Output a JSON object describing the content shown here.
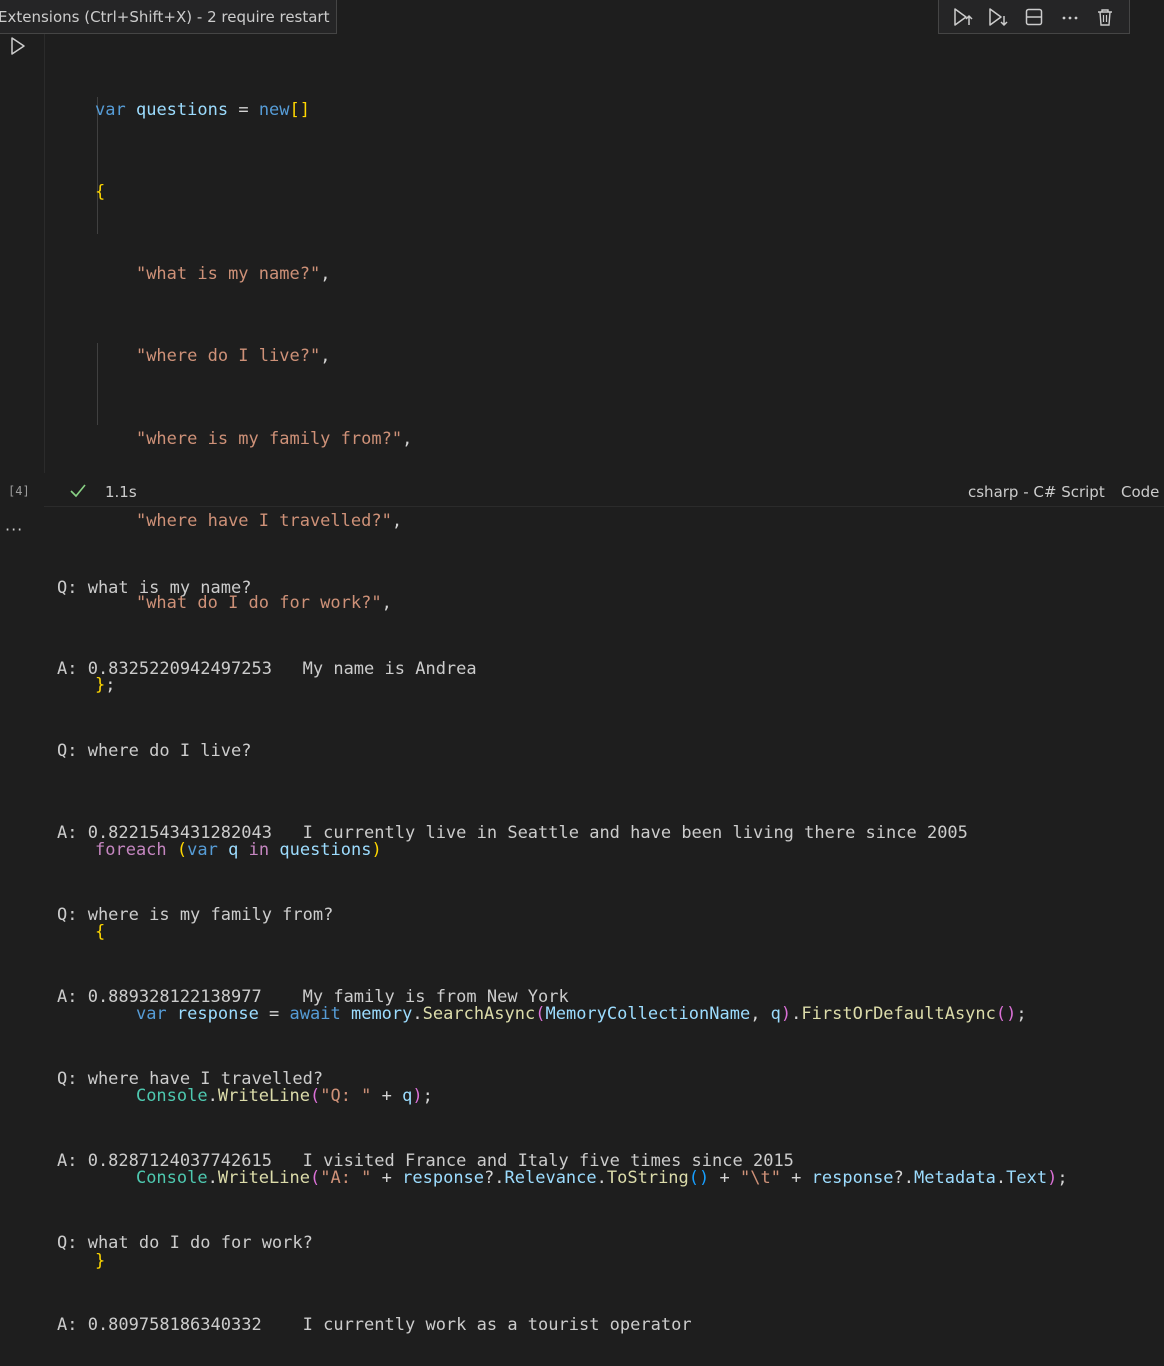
{
  "tooltip": {
    "text": "Extensions (Ctrl+Shift+X) - 2 require restart"
  },
  "toolbar": {
    "buttons": [
      {
        "name": "run-above",
        "icon": "run-above-icon"
      },
      {
        "name": "run-below",
        "icon": "run-below-icon"
      },
      {
        "name": "split-cell",
        "icon": "split-cell-icon"
      },
      {
        "name": "more-actions",
        "icon": "ellipsis-icon"
      },
      {
        "name": "delete-cell",
        "icon": "trash-icon"
      }
    ]
  },
  "cell": {
    "execution_count": "[4]",
    "time": "1.1s",
    "language": "csharp - C# Script",
    "mode": "Code",
    "code_lines": [
      "var questions = new[]",
      "{",
      "    \"what is my name?\",",
      "    \"where do I live?\",",
      "    \"where is my family from?\",",
      "    \"where have I travelled?\",",
      "    \"what do I do for work?\",",
      "};",
      "",
      "foreach (var q in questions)",
      "{",
      "    var response = await memory.SearchAsync(MemoryCollectionName, q).FirstOrDefaultAsync();",
      "    Console.WriteLine(\"Q: \" + q);",
      "    Console.WriteLine(\"A: \" + response?.Relevance.ToString() + \"\\t\" + response?.Metadata.Text);",
      "}"
    ]
  },
  "output": {
    "ellipsis": "···",
    "lines": [
      "Q: what is my name?",
      "A: 0.8325220942497253   My name is Andrea",
      "Q: where do I live?",
      "A: 0.8221543431282043   I currently live in Seattle and have been living there since 2005",
      "Q: where is my family from?",
      "A: 0.889328122138977    My family is from New York",
      "Q: where have I travelled?",
      "A: 0.8287124037742615   I visited France and Italy five times since 2015",
      "Q: what do I do for work?",
      "A: 0.809758186340332    I currently work as a tourist operator"
    ]
  }
}
